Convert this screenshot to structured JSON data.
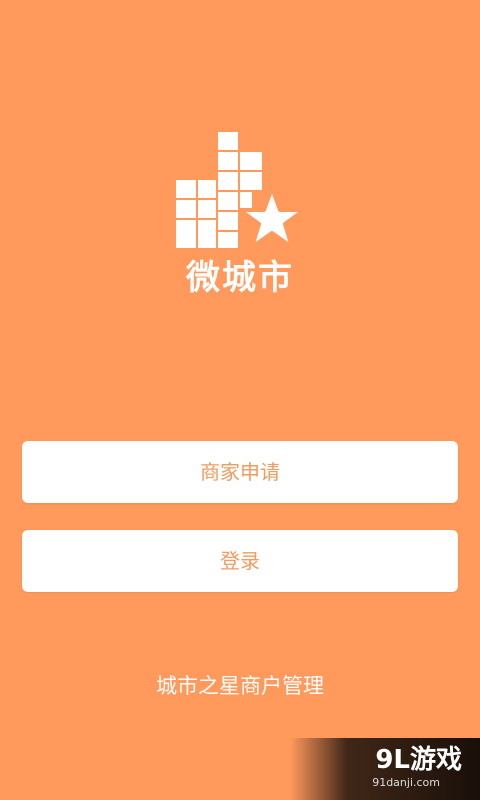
{
  "app": {
    "logo_text": "微城市",
    "logo_icon": "building-star-icon",
    "footer_text": "城市之星商户管理"
  },
  "buttons": {
    "apply_label": "商家申请",
    "login_label": "登录"
  },
  "watermark": {
    "main_text": "9L游戏",
    "sub_text": "91danji.com"
  },
  "colors": {
    "background": "#FF9A5C",
    "button_text": "#F39A5E",
    "button_bg": "#FFFFFF"
  }
}
